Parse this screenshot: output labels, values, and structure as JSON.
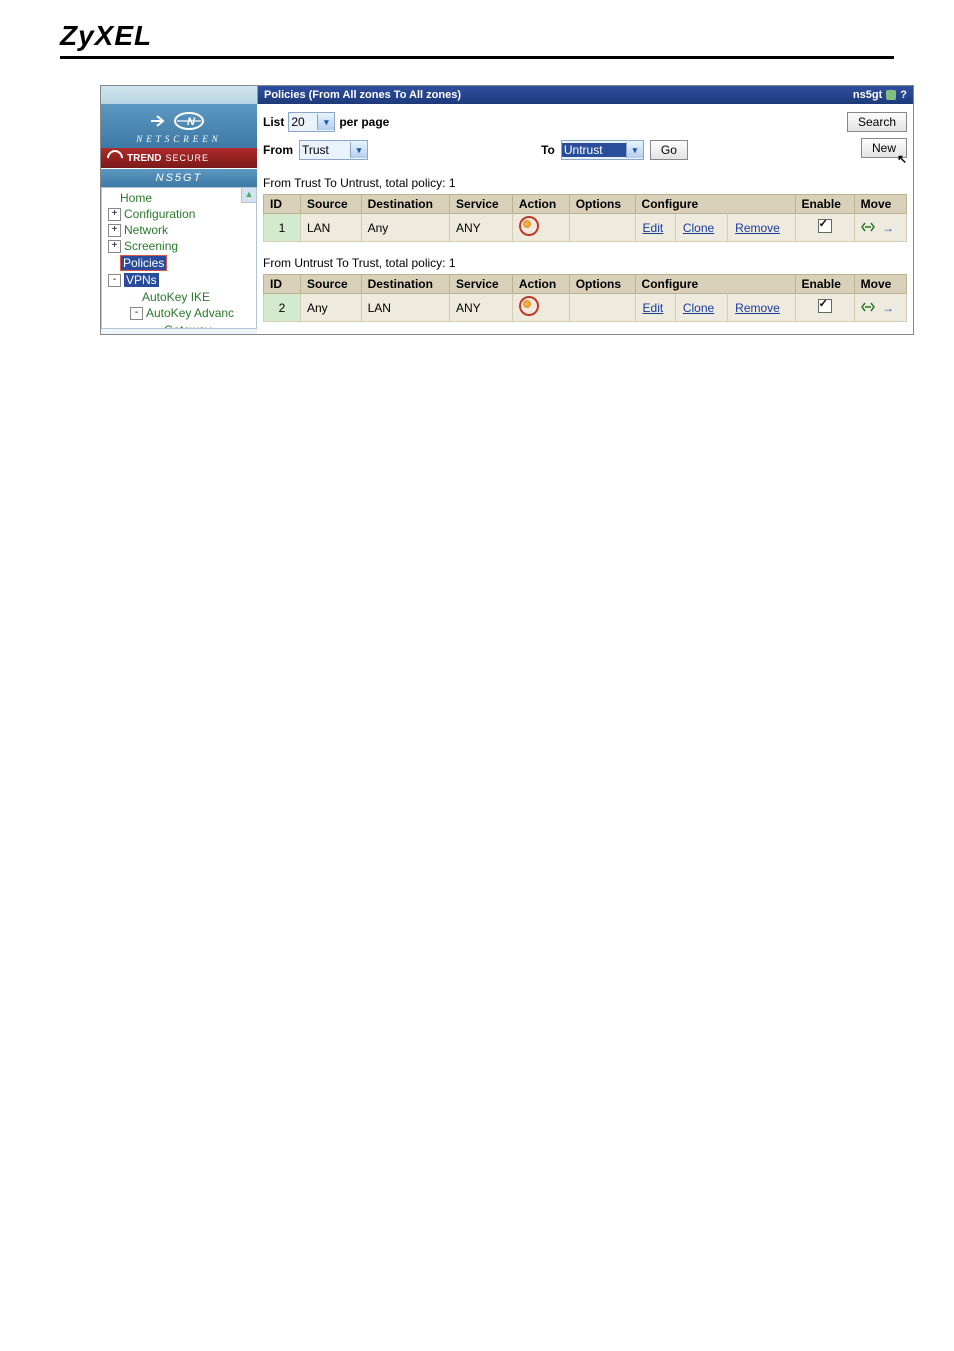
{
  "brand": "ZyXEL",
  "topbar": {
    "title": "Policies (From All zones To All zones)",
    "device": "ns5gt"
  },
  "sidebar": {
    "logo_sub": "NETSCREEN",
    "trend1": "TREND",
    "trend2": "SECURE",
    "device": "NS5GT",
    "items": [
      "Home",
      "Configuration",
      "Network",
      "Screening",
      "Policies",
      "VPNs"
    ],
    "vpn_children": [
      "AutoKey IKE",
      "AutoKey Advanc",
      "Gateway"
    ]
  },
  "controls": {
    "list_label": "List",
    "per_page": "20",
    "per_page_label": "per page",
    "from_label": "From",
    "from_value": "Trust",
    "to_label": "To",
    "to_value": "Untrust",
    "go": "Go",
    "search": "Search",
    "new": "New"
  },
  "columns": [
    "ID",
    "Source",
    "Destination",
    "Service",
    "Action",
    "Options",
    "Configure",
    "Enable",
    "Move"
  ],
  "configure": [
    "Edit",
    "Clone",
    "Remove"
  ],
  "sections": [
    {
      "title": "From Trust To Untrust, total policy: 1",
      "rows": [
        {
          "id": "1",
          "source": "LAN",
          "destination": "Any",
          "service": "ANY",
          "enable": true
        }
      ]
    },
    {
      "title": "From Untrust To Trust, total policy: 1",
      "rows": [
        {
          "id": "2",
          "source": "Any",
          "destination": "LAN",
          "service": "ANY",
          "enable": true
        }
      ]
    }
  ]
}
